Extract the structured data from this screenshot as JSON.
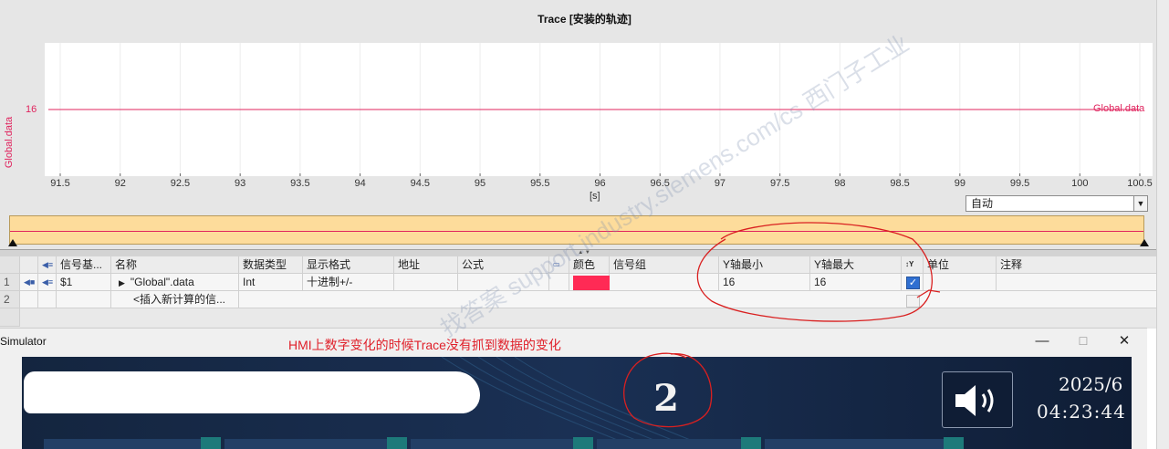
{
  "trace": {
    "title": "Trace [安装的轨迹]",
    "y_axis_label": "Global.data",
    "y_tick": "16",
    "series_label": "Global.data",
    "x_unit": "[s]",
    "x_ticks": [
      "91.5",
      "92",
      "92.5",
      "93",
      "93.5",
      "94",
      "94.5",
      "95",
      "95.5",
      "96",
      "96.5",
      "97",
      "97.5",
      "98",
      "98.5",
      "99",
      "99.5",
      "100",
      "100.5"
    ],
    "scale_select": "自动",
    "series_color": "#e0245e"
  },
  "chart_data": {
    "type": "line",
    "title": "Trace [安装的轨迹]",
    "xlabel": "[s]",
    "ylabel": "Global.data",
    "xlim": [
      91.4,
      100.5
    ],
    "series": [
      {
        "name": "Global.data",
        "x": [
          91.4,
          100.5
        ],
        "values": [
          16,
          16
        ]
      }
    ],
    "grid": true
  },
  "table": {
    "headers": [
      "信号基...",
      "名称",
      "数据类型",
      "显示格式",
      "地址",
      "公式",
      "颜色",
      "信号组",
      "Y轴最小",
      "Y轴最大",
      "单位",
      "注释"
    ],
    "rows": [
      {
        "num": "1",
        "signal_base": "$1",
        "name": "\"Global\".data",
        "data_type": "Int",
        "format": "十进制+/-",
        "address": "",
        "formula": "",
        "color": "#ff2a55",
        "group": "",
        "y_min": "16",
        "y_max": "16",
        "autoscale": true,
        "unit": "",
        "comment": ""
      },
      {
        "num": "2",
        "name": "<插入新计算的信..."
      }
    ]
  },
  "simulator": {
    "title": "Simulator",
    "annotation": "HMI上数字变化的时候Trace没有抓到数据的变化",
    "value": "2",
    "date": "2025/6",
    "time": "04:23:44"
  },
  "watermark": "找答案 support.industry.siemens.com/cs 西门子工业"
}
